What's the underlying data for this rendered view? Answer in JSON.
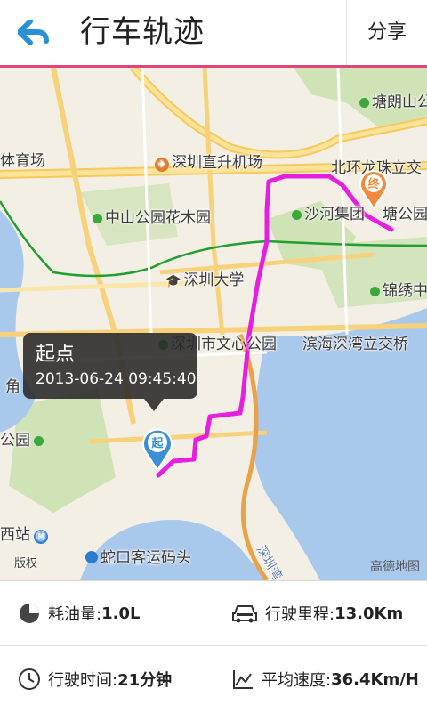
{
  "header": {
    "back_icon": "back-arrow-icon",
    "title": "行车轨迹",
    "share_label": "分享"
  },
  "map": {
    "labels": {
      "tianghuang": "塘朗山公",
      "sports": "体育场",
      "heliport": "深圳直升机场",
      "beihuan": "北环龙珠立交",
      "zhongshan": "中山公园花木园",
      "shahe": "沙河集团",
      "tanggong": "塘公园",
      "szu": "深圳大学",
      "jinxiu": "锦绣中",
      "culture_park": "深圳市文心公园",
      "binhai": "滨海深湾立交桥",
      "jiao": "角",
      "gongyuan": "公园",
      "xizhan": "西站",
      "shekou": "蛇口客运码头",
      "banquan": "版权",
      "shenzhen_bay": "深圳湾"
    },
    "start_marker": {
      "glyph": "起",
      "tip_title": "起点",
      "tip_time": "2013-06-24 09:45:40"
    },
    "end_marker": {
      "glyph": "终"
    },
    "watermark": "高德地图",
    "route_color": "#e61ee0"
  },
  "stats": {
    "fuel": {
      "icon": "pie-chart-icon",
      "label": "耗油量:",
      "value": "1.0L"
    },
    "distance": {
      "icon": "car-icon",
      "label": "行驶里程:",
      "value": "13.0Km"
    },
    "time": {
      "icon": "clock-icon",
      "label": "行驶时间:",
      "value": "21分钟"
    },
    "speed": {
      "icon": "speed-chart-icon",
      "label": "平均速度:",
      "value": "36.4Km/H"
    }
  }
}
